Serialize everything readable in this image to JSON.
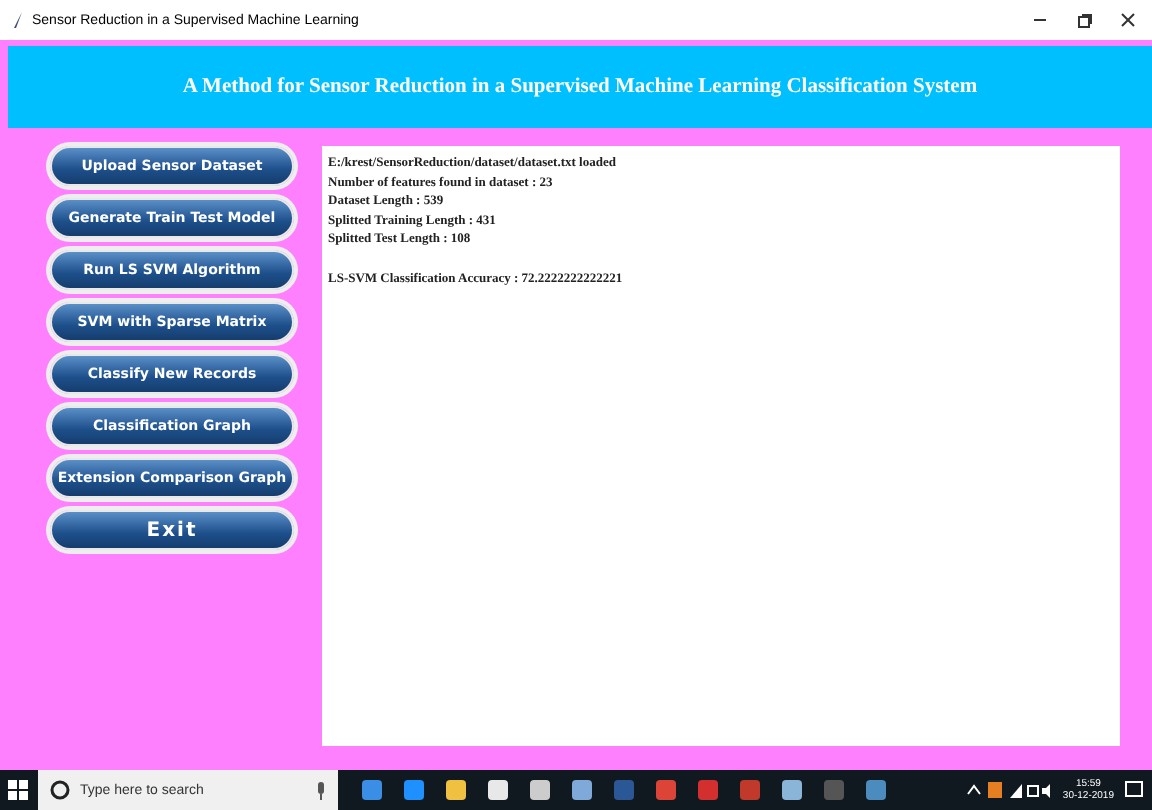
{
  "window": {
    "title": "Sensor Reduction in a Supervised Machine Learning"
  },
  "header": {
    "title": "A Method for Sensor Reduction in a Supervised Machine Learning Classification System"
  },
  "buttons": [
    {
      "label": "Upload Sensor Dataset"
    },
    {
      "label": "Generate Train Test Model"
    },
    {
      "label": "Run LS SVM Algorithm"
    },
    {
      "label": "SVM with Sparse Matrix"
    },
    {
      "label": "Classify New Records"
    },
    {
      "label": "Classification Graph"
    },
    {
      "label": "Extension Comparison Graph"
    },
    {
      "label": "Exit",
      "kind": "exit"
    }
  ],
  "output": {
    "log_lines": [
      "E:/krest/SensorReduction/dataset/dataset.txt loaded",
      "Number of features found in dataset : 23",
      "Dataset Length : 539",
      "Splitted Training Length : 431",
      "Splitted Test Length : 108"
    ],
    "result_lines": [
      "LS-SVM Classification Accuracy : 72.2222222222221"
    ]
  },
  "taskbar": {
    "search_placeholder": "Type here to search",
    "time": "15:59",
    "date": "30-12-2019"
  }
}
